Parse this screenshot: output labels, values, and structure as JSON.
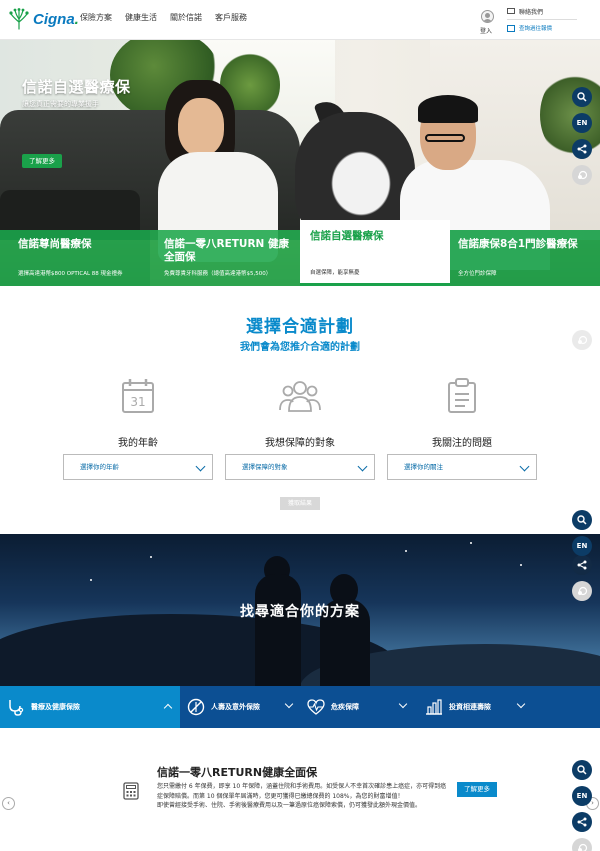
{
  "header": {
    "brand": "Cigna",
    "nav": [
      "保險方案",
      "健康生活",
      "關於信諾",
      "客戶服務"
    ],
    "login_label": "登入",
    "contact_label": "聯絡我們",
    "appointment_label": "查詢過往報價"
  },
  "hero": {
    "title": "信諾自選醫療保",
    "subtitle": "讓您真正需要的專業援手",
    "cta": "了解更多"
  },
  "plan_tabs": [
    {
      "title": "信諾尊尚醫療保",
      "subtitle": "選擇高達港幣$800 OPTICAL 88 現金禮券"
    },
    {
      "title": "信諾一零八RETURN 健康全面保",
      "subtitle": "免費尊貴牙科服務（總值高達港幣$5,500）"
    },
    {
      "title": "信諾自選醫療保",
      "subtitle": "自選保障，能享無憂"
    },
    {
      "title": "信諾康保8合1門診醫療保",
      "subtitle": "全方位門診保障"
    }
  ],
  "side_buttons": {
    "en": "EN"
  },
  "finder": {
    "title": "選擇合適計劃",
    "subtitle": "我們會為您推介合適的計劃",
    "columns": [
      {
        "label": "我的年齡",
        "placeholder": "選擇你的年齡",
        "icon": "calendar-icon"
      },
      {
        "label": "我想保障的對象",
        "placeholder": "選擇保障的對象",
        "icon": "people-icon"
      },
      {
        "label": "我關注的問題",
        "placeholder": "選擇你的關注",
        "icon": "clipboard-icon"
      }
    ],
    "calendar_number": "31",
    "submit": "獲取結果"
  },
  "night": {
    "title": "找尋適合你的方案"
  },
  "categories": [
    {
      "label": "醫療及健康保險",
      "active": true
    },
    {
      "label": "人壽及意外保險",
      "active": false
    },
    {
      "label": "危疾保障",
      "active": false
    },
    {
      "label": "投資相連壽險",
      "active": false
    }
  ],
  "product": {
    "title": "信諾一零八RETURN健康全面保",
    "description_1": "您只需繳付 6 年保費，即享 10 年保障，涵蓋住院和手術費用。如受保人不幸首次確診患上癌症，亦可得到癌症保障賠償。而第 10 個保單年屆滿時，您更可獲得已繳總保費的 108%，為您的財富增值！",
    "description_2": "即使曾經接受手術、住院、手術後醫療費用以及一筆過原位癌保障索償，仍可獲發此額外現金價值。",
    "cta": "了解更多"
  },
  "colors": {
    "green": "#1aa14a",
    "blue": "#0a8acb",
    "navy": "#0c4f93",
    "dark_circle": "#0c3c66"
  }
}
